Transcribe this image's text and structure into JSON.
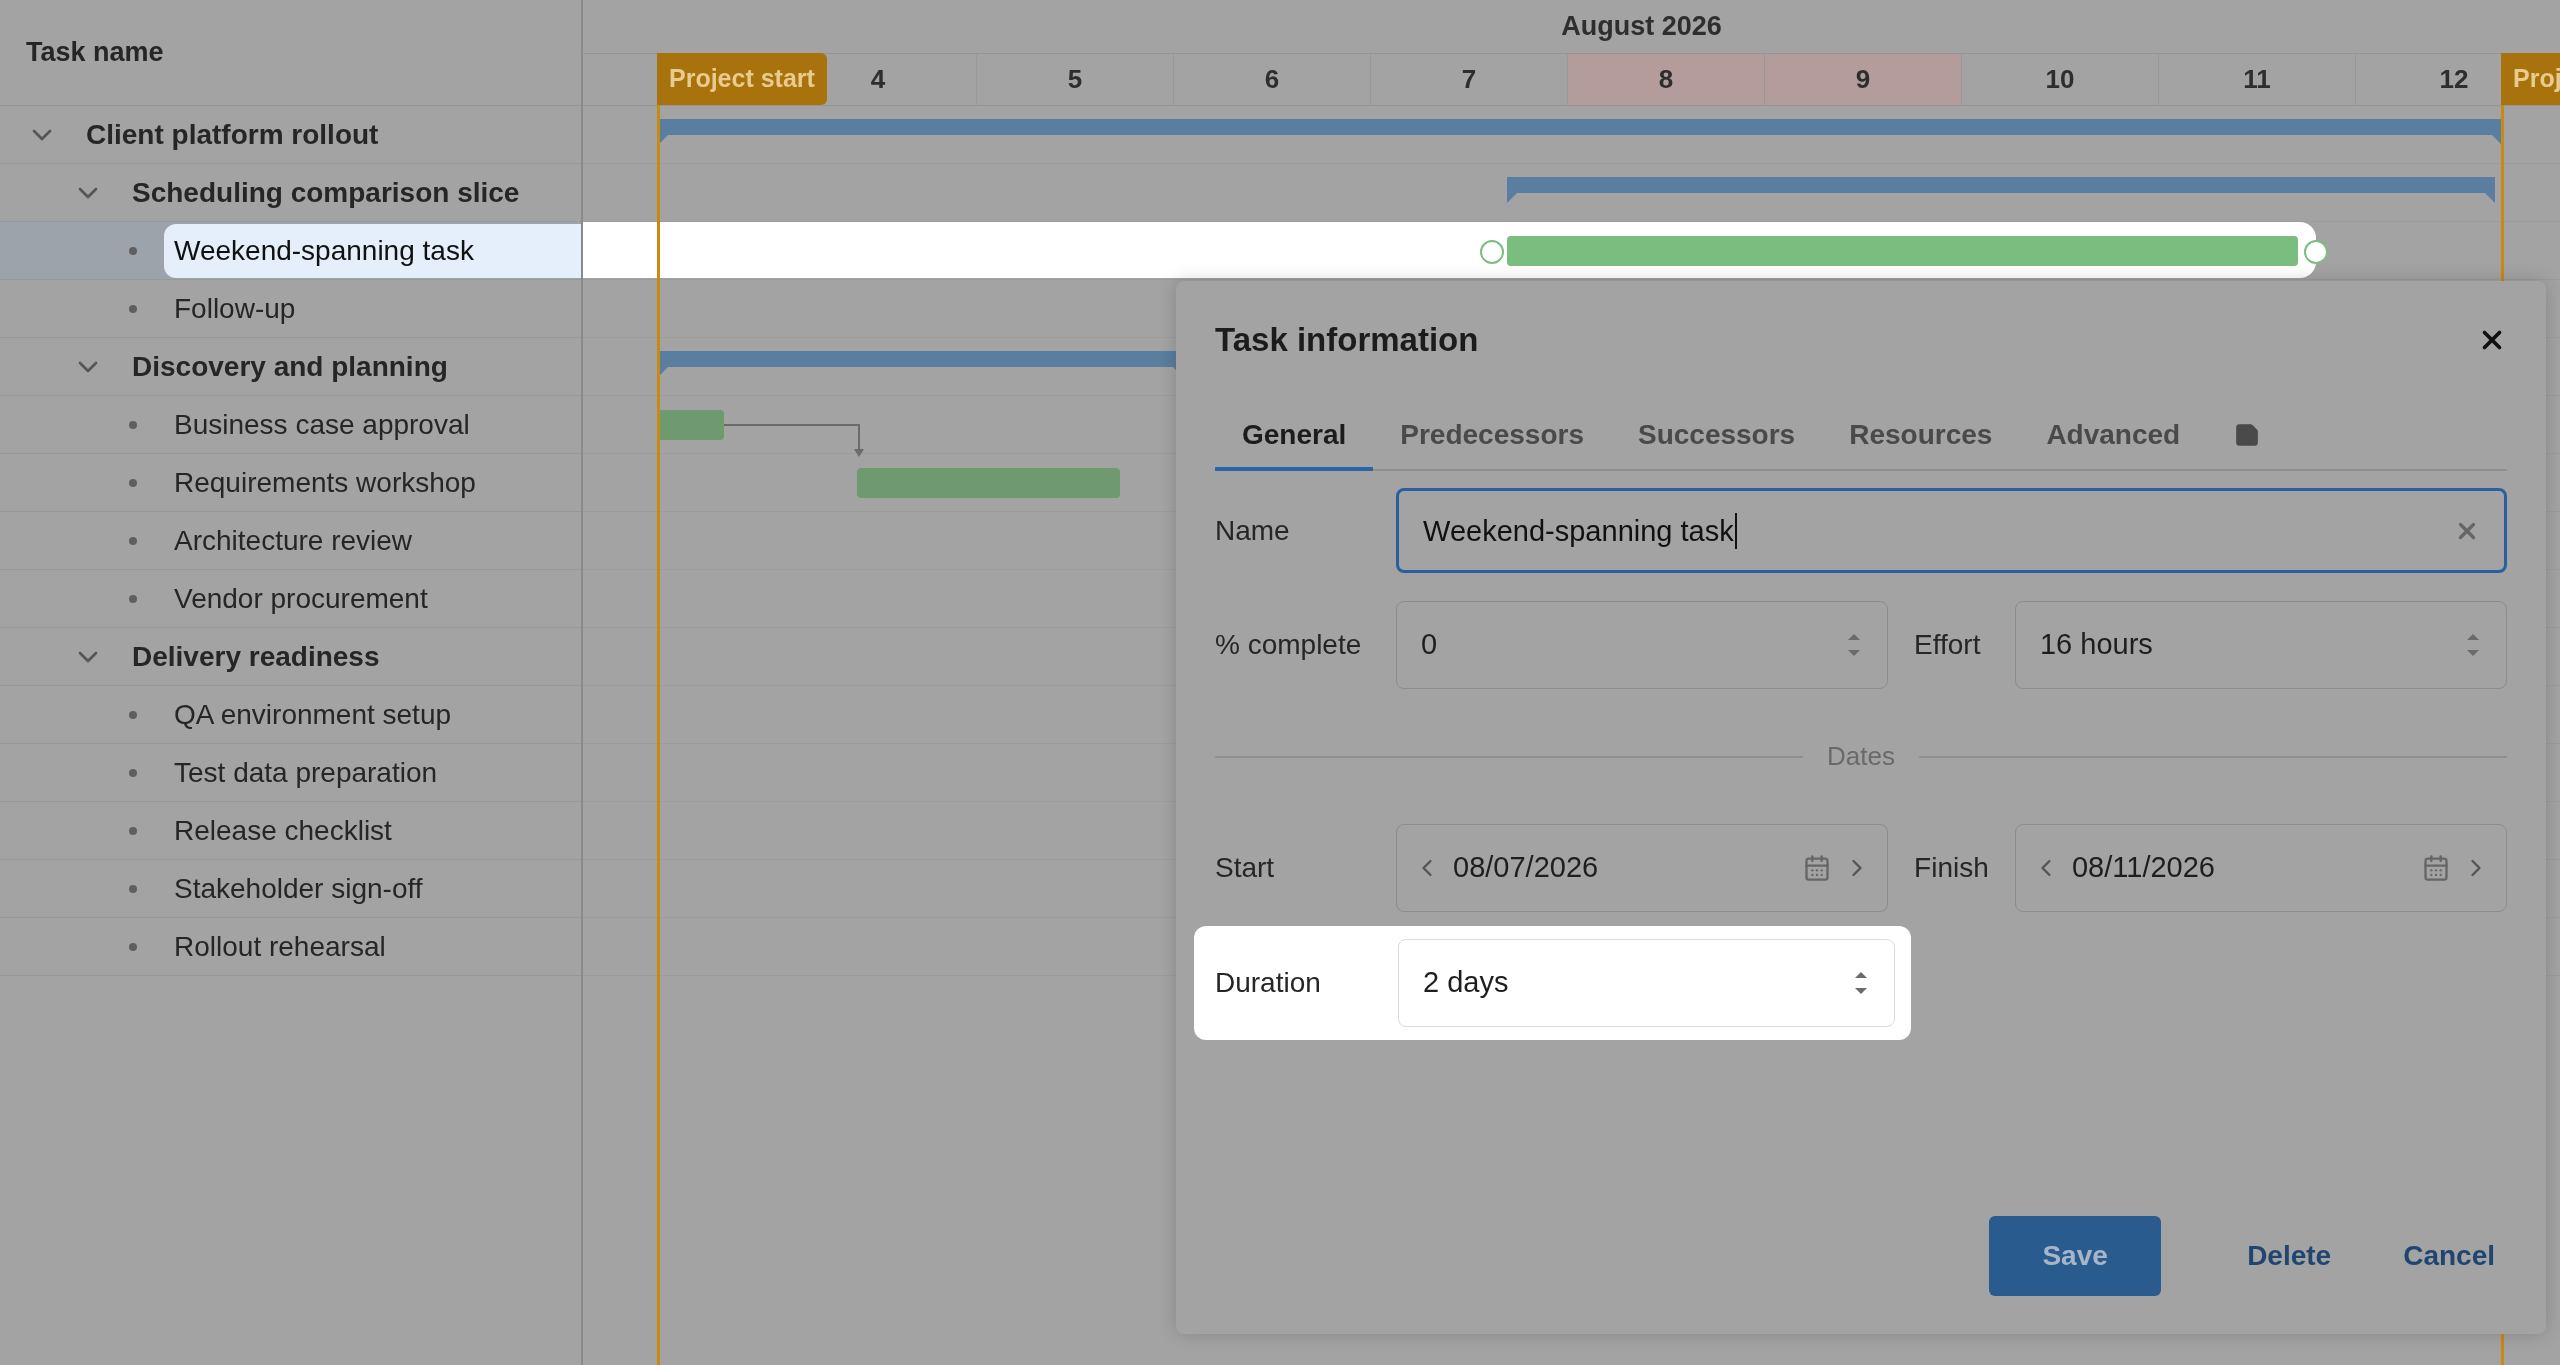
{
  "tree": {
    "header": "Task name",
    "items": [
      {
        "name": "Client platform rollout",
        "expanded": true,
        "children": [
          {
            "name": "Scheduling comparison slice",
            "expanded": true,
            "children": [
              {
                "name": "Weekend-spanning task",
                "selected": true
              },
              {
                "name": "Follow-up",
                "selected": false
              }
            ]
          },
          {
            "name": "Discovery and planning",
            "expanded": true,
            "children": [
              {
                "name": "Business case approval",
                "selected": false
              },
              {
                "name": "Requirements workshop",
                "selected": false
              },
              {
                "name": "Architecture review",
                "selected": false
              },
              {
                "name": "Vendor procurement",
                "selected": false
              }
            ]
          },
          {
            "name": "Delivery readiness",
            "expanded": true,
            "children": [
              {
                "name": "QA environment setup",
                "selected": false
              },
              {
                "name": "Test data preparation",
                "selected": false
              },
              {
                "name": "Release checklist",
                "selected": false
              },
              {
                "name": "Stakeholder sign-off",
                "selected": false
              },
              {
                "name": "Rollout rehearsal",
                "selected": false
              }
            ]
          }
        ]
      }
    ]
  },
  "timeline": {
    "month": "August 2026",
    "days": [
      {
        "label": "4",
        "weekend": false
      },
      {
        "label": "5",
        "weekend": false
      },
      {
        "label": "6",
        "weekend": false
      },
      {
        "label": "7",
        "weekend": false
      },
      {
        "label": "8",
        "weekend": true
      },
      {
        "label": "9",
        "weekend": true
      },
      {
        "label": "10",
        "weekend": false
      },
      {
        "label": "11",
        "weekend": false
      },
      {
        "label": "12",
        "weekend": false
      }
    ],
    "milestones": [
      {
        "label": "Project start"
      },
      {
        "label": "Proj"
      }
    ]
  },
  "dialog": {
    "title": "Task information",
    "tabs": [
      {
        "kind": "text",
        "label": "General",
        "selected": true
      },
      {
        "kind": "text",
        "label": "Predecessors",
        "selected": false
      },
      {
        "kind": "text",
        "label": "Successors",
        "selected": false
      },
      {
        "kind": "text",
        "label": "Resources",
        "selected": false
      },
      {
        "kind": "text",
        "label": "Advanced",
        "selected": false
      },
      {
        "kind": "icon",
        "selected": false
      }
    ],
    "name": {
      "label": "Name",
      "value": "Weekend-spanning task"
    },
    "percent": {
      "label": "% complete",
      "value": "0"
    },
    "effort": {
      "label": "Effort",
      "value": "16 hours"
    },
    "section": "Dates",
    "start": {
      "label": "Start",
      "value": "08/07/2026"
    },
    "finish": {
      "label": "Finish",
      "value": "08/11/2026"
    },
    "duration": {
      "label": "Duration",
      "value": "2 days",
      "highlighted": true
    },
    "buttons": [
      {
        "kind": "primary",
        "label": "Save"
      },
      {
        "kind": "text",
        "label": "Delete"
      },
      {
        "kind": "text",
        "label": "Cancel"
      }
    ]
  }
}
